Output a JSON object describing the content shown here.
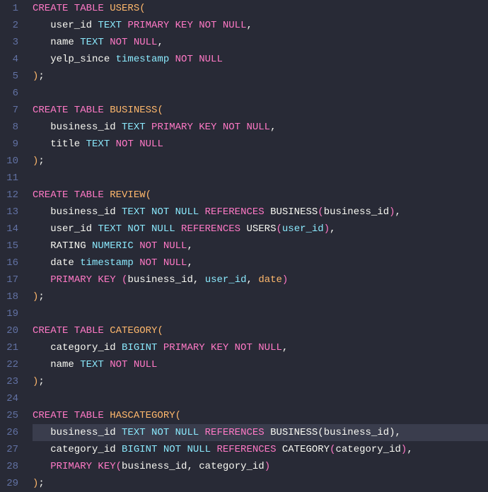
{
  "editor": {
    "language": "sql",
    "highlighted_line": 26,
    "lines": [
      {
        "n": 1,
        "seg": [
          [
            "kw",
            "CREATE TABLE "
          ],
          [
            "name",
            "USERS"
          ],
          [
            "paren",
            "("
          ]
        ]
      },
      {
        "n": 2,
        "seg": [
          [
            "ident",
            "   user_id "
          ],
          [
            "type",
            "TEXT "
          ],
          [
            "kw",
            "PRIMARY KEY NOT NULL"
          ],
          [
            "punct",
            ","
          ]
        ]
      },
      {
        "n": 3,
        "seg": [
          [
            "ident",
            "   name "
          ],
          [
            "type",
            "TEXT "
          ],
          [
            "kw",
            "NOT NULL"
          ],
          [
            "punct",
            ","
          ]
        ]
      },
      {
        "n": 4,
        "seg": [
          [
            "ident",
            "   yelp_since "
          ],
          [
            "type",
            "timestamp "
          ],
          [
            "kw",
            "NOT NULL"
          ]
        ]
      },
      {
        "n": 5,
        "seg": [
          [
            "paren",
            ")"
          ],
          [
            "punct",
            ";"
          ]
        ]
      },
      {
        "n": 6,
        "seg": []
      },
      {
        "n": 7,
        "seg": [
          [
            "kw",
            "CREATE TABLE "
          ],
          [
            "name",
            "BUSINESS"
          ],
          [
            "paren",
            "("
          ]
        ]
      },
      {
        "n": 8,
        "seg": [
          [
            "ident",
            "   business_id "
          ],
          [
            "type",
            "TEXT "
          ],
          [
            "kw",
            "PRIMARY KEY NOT NULL"
          ],
          [
            "punct",
            ","
          ]
        ]
      },
      {
        "n": 9,
        "seg": [
          [
            "ident",
            "   title "
          ],
          [
            "type",
            "TEXT "
          ],
          [
            "kw",
            "NOT NULL"
          ]
        ]
      },
      {
        "n": 10,
        "seg": [
          [
            "paren",
            ")"
          ],
          [
            "punct",
            ";"
          ]
        ]
      },
      {
        "n": 11,
        "seg": []
      },
      {
        "n": 12,
        "seg": [
          [
            "kw",
            "CREATE TABLE "
          ],
          [
            "name",
            "REVIEW"
          ],
          [
            "paren",
            "("
          ]
        ]
      },
      {
        "n": 13,
        "seg": [
          [
            "ident",
            "   business_id "
          ],
          [
            "type",
            "TEXT NOT NULL "
          ],
          [
            "kw",
            "REFERENCES "
          ],
          [
            "ident",
            "BUSINESS"
          ],
          [
            "parenP",
            "("
          ],
          [
            "ident",
            "business_id"
          ],
          [
            "parenP",
            ")"
          ],
          [
            "punct",
            ","
          ]
        ]
      },
      {
        "n": 14,
        "seg": [
          [
            "ident",
            "   user_id "
          ],
          [
            "type",
            "TEXT NOT NULL "
          ],
          [
            "kw",
            "REFERENCES "
          ],
          [
            "ident",
            "USERS"
          ],
          [
            "parenP",
            "("
          ],
          [
            "cyan",
            "user_id"
          ],
          [
            "parenP",
            ")"
          ],
          [
            "punct",
            ","
          ]
        ]
      },
      {
        "n": 15,
        "seg": [
          [
            "ident",
            "   RATING "
          ],
          [
            "type",
            "NUMERIC "
          ],
          [
            "kw",
            "NOT NULL"
          ],
          [
            "punct",
            ","
          ]
        ]
      },
      {
        "n": 16,
        "seg": [
          [
            "ident",
            "   date "
          ],
          [
            "type",
            "timestamp "
          ],
          [
            "kw",
            "NOT NULL"
          ],
          [
            "punct",
            ","
          ]
        ]
      },
      {
        "n": 17,
        "seg": [
          [
            "ident",
            "   "
          ],
          [
            "kw",
            "PRIMARY KEY "
          ],
          [
            "parenP",
            "("
          ],
          [
            "ident",
            "business_id"
          ],
          [
            "punct",
            ", "
          ],
          [
            "cyan",
            "user_id"
          ],
          [
            "punct",
            ", "
          ],
          [
            "paren",
            "date"
          ],
          [
            "parenP",
            ")"
          ]
        ]
      },
      {
        "n": 18,
        "seg": [
          [
            "paren",
            ")"
          ],
          [
            "punct",
            ";"
          ]
        ]
      },
      {
        "n": 19,
        "seg": []
      },
      {
        "n": 20,
        "seg": [
          [
            "kw",
            "CREATE TABLE "
          ],
          [
            "name",
            "CATEGORY"
          ],
          [
            "paren",
            "("
          ]
        ]
      },
      {
        "n": 21,
        "seg": [
          [
            "ident",
            "   category_id "
          ],
          [
            "type",
            "BIGINT "
          ],
          [
            "kw",
            "PRIMARY KEY NOT NULL"
          ],
          [
            "punct",
            ","
          ]
        ]
      },
      {
        "n": 22,
        "seg": [
          [
            "ident",
            "   name "
          ],
          [
            "type",
            "TEXT "
          ],
          [
            "kw",
            "NOT NULL"
          ]
        ]
      },
      {
        "n": 23,
        "seg": [
          [
            "paren",
            ")"
          ],
          [
            "punct",
            ";"
          ]
        ]
      },
      {
        "n": 24,
        "seg": []
      },
      {
        "n": 25,
        "seg": [
          [
            "kw",
            "CREATE TABLE "
          ],
          [
            "name",
            "HASCATEGORY"
          ],
          [
            "paren",
            "("
          ]
        ]
      },
      {
        "n": 26,
        "seg": [
          [
            "ident",
            "   business_id "
          ],
          [
            "type",
            "TEXT NOT NULL "
          ],
          [
            "kw",
            "REFERENCES "
          ],
          [
            "ident",
            "BUSINESS"
          ],
          [
            "parenW",
            "("
          ],
          [
            "ident",
            "business_id"
          ],
          [
            "parenW",
            ")"
          ],
          [
            "punct",
            ","
          ]
        ]
      },
      {
        "n": 27,
        "seg": [
          [
            "ident",
            "   category_id "
          ],
          [
            "type",
            "BIGINT NOT NULL "
          ],
          [
            "kw",
            "REFERENCES "
          ],
          [
            "ident",
            "CATEGORY"
          ],
          [
            "parenP",
            "("
          ],
          [
            "ident",
            "category_id"
          ],
          [
            "parenP",
            ")"
          ],
          [
            "punct",
            ","
          ]
        ]
      },
      {
        "n": 28,
        "seg": [
          [
            "ident",
            "   "
          ],
          [
            "kw",
            "PRIMARY KEY"
          ],
          [
            "parenP",
            "("
          ],
          [
            "ident",
            "business_id"
          ],
          [
            "punct",
            ", "
          ],
          [
            "ident",
            "category_id"
          ],
          [
            "parenP",
            ")"
          ]
        ]
      },
      {
        "n": 29,
        "seg": [
          [
            "paren",
            ")"
          ],
          [
            "punct",
            ";"
          ]
        ]
      }
    ]
  }
}
